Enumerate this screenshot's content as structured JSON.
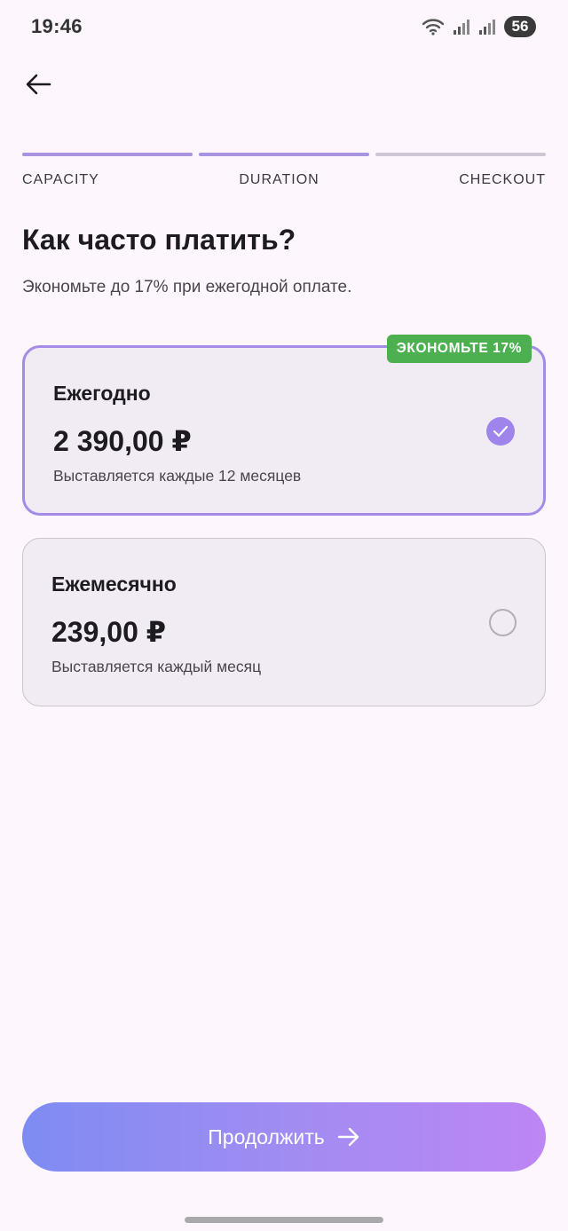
{
  "status_bar": {
    "time": "19:46",
    "battery": "56"
  },
  "stepper": {
    "steps": [
      {
        "label": "CAPACITY",
        "active": true
      },
      {
        "label": "DURATION",
        "active": true
      },
      {
        "label": "CHECKOUT",
        "active": false
      }
    ]
  },
  "header": {
    "title": "Как часто платить?",
    "subtitle": "Экономьте до 17% при ежегодной оплате."
  },
  "plans": {
    "yearly": {
      "name": "Ежегодно",
      "price": "2 390,00 ₽",
      "billing": "Выставляется каждые 12 месяцев",
      "badge": "ЭКОНОМЬТЕ 17%",
      "selected": true
    },
    "monthly": {
      "name": "Ежемесячно",
      "price": "239,00 ₽",
      "billing": "Выставляется каждый месяц",
      "selected": false
    }
  },
  "actions": {
    "continue_label": "Продолжить"
  },
  "colors": {
    "accent": "#a48be6",
    "badge_green": "#4caf50",
    "background": "#fdf7fd"
  },
  "icons": {
    "back": "arrow-left-icon",
    "check": "check-icon",
    "continue": "arrow-right-icon"
  }
}
